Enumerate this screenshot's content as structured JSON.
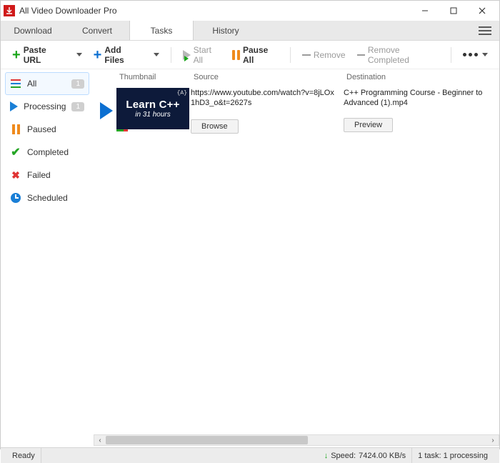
{
  "window": {
    "title": "All Video Downloader Pro"
  },
  "tabs": {
    "t0": "Download",
    "t1": "Convert",
    "t2": "Tasks",
    "t3": "History"
  },
  "toolbar": {
    "paste": "Paste URL",
    "addfiles": "Add Files",
    "startall": "Start All",
    "pauseall": "Pause All",
    "remove": "Remove",
    "removecompleted": "Remove Completed"
  },
  "sidebar": {
    "all": {
      "label": "All",
      "badge": "1"
    },
    "processing": {
      "label": "Processing",
      "badge": "1"
    },
    "paused": {
      "label": "Paused"
    },
    "completed": {
      "label": "Completed"
    },
    "failed": {
      "label": "Failed"
    },
    "scheduled": {
      "label": "Scheduled"
    }
  },
  "columns": {
    "thumb": "Thumbnail",
    "src": "Source",
    "dst": "Destination"
  },
  "task": {
    "thumb_line1": "Learn C++",
    "thumb_line2": "in 31 hours",
    "thumb_cc": "{A}",
    "source": "https://www.youtube.com/watch?v=8jLOx1hD3_o&t=2627s",
    "browse": "Browse",
    "destination": "C++ Programming Course - Beginner to Advanced (1).mp4",
    "preview": "Preview"
  },
  "status": {
    "ready": "Ready",
    "speed_label": "Speed:",
    "speed_value": "7424.00 KB/s",
    "tasks": "1 task: 1 processing"
  }
}
